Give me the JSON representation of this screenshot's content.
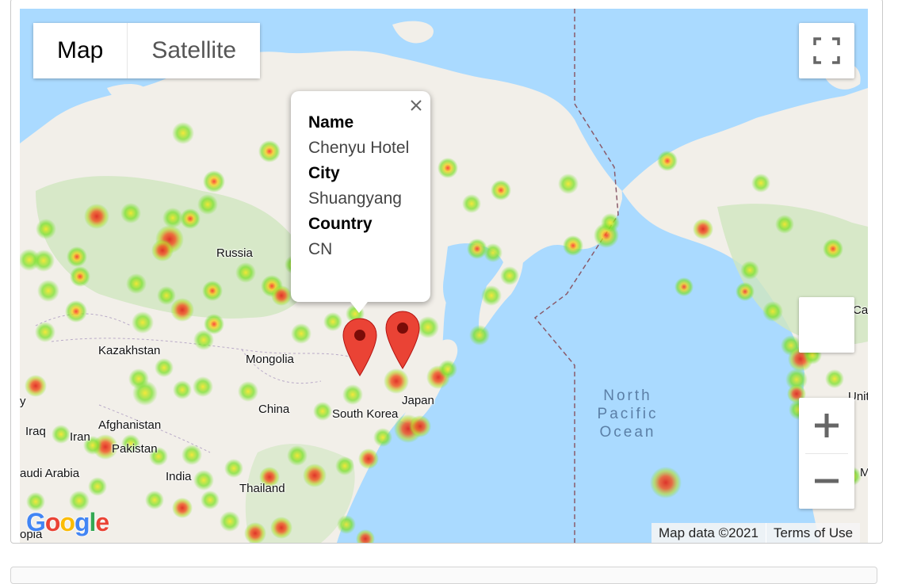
{
  "map": {
    "type_controls": {
      "map_label": "Map",
      "satellite_label": "Satellite",
      "active": "Map"
    },
    "place_labels": {
      "russia": "Russia",
      "kazakhstan": "Kazakhstan",
      "mongolia": "Mongolia",
      "china": "China",
      "south_korea": "South Korea",
      "japan": "Japan",
      "afghanistan": "Afghanistan",
      "iraq": "Iraq",
      "iran": "Iran",
      "pakistan": "Pakistan",
      "saudi_arabia": "audi Arabia",
      "india": "India",
      "thailand": "Thailand",
      "opia": "opia",
      "ca_edge": "Ca",
      "unit_edge": "Unit",
      "m_edge": "M",
      "y_edge": "y"
    },
    "ocean_label": [
      "North",
      "Pacific",
      "Ocean"
    ],
    "info_window": {
      "name_key": "Name",
      "name_value": "Chenyu Hotel",
      "city_key": "City",
      "city_value": "Shuangyang",
      "country_key": "Country",
      "country_value": "CN"
    },
    "attribution": {
      "map_data": "Map data ©2021",
      "terms": "Terms of Use"
    },
    "logo": [
      "G",
      "o",
      "o",
      "g",
      "l",
      "e"
    ],
    "colors": {
      "water": "#aadaff",
      "land": "#f2efe9",
      "forest": "#cfe6bf",
      "marker": "#ea4335",
      "heat_low": "#7ee02a",
      "heat_high": "#e0352a"
    },
    "icons": {
      "fullscreen": "fullscreen-icon",
      "zoom_in": "plus-icon",
      "zoom_out": "minus-icon",
      "close": "close-icon",
      "marker": "map-pin-icon"
    }
  }
}
